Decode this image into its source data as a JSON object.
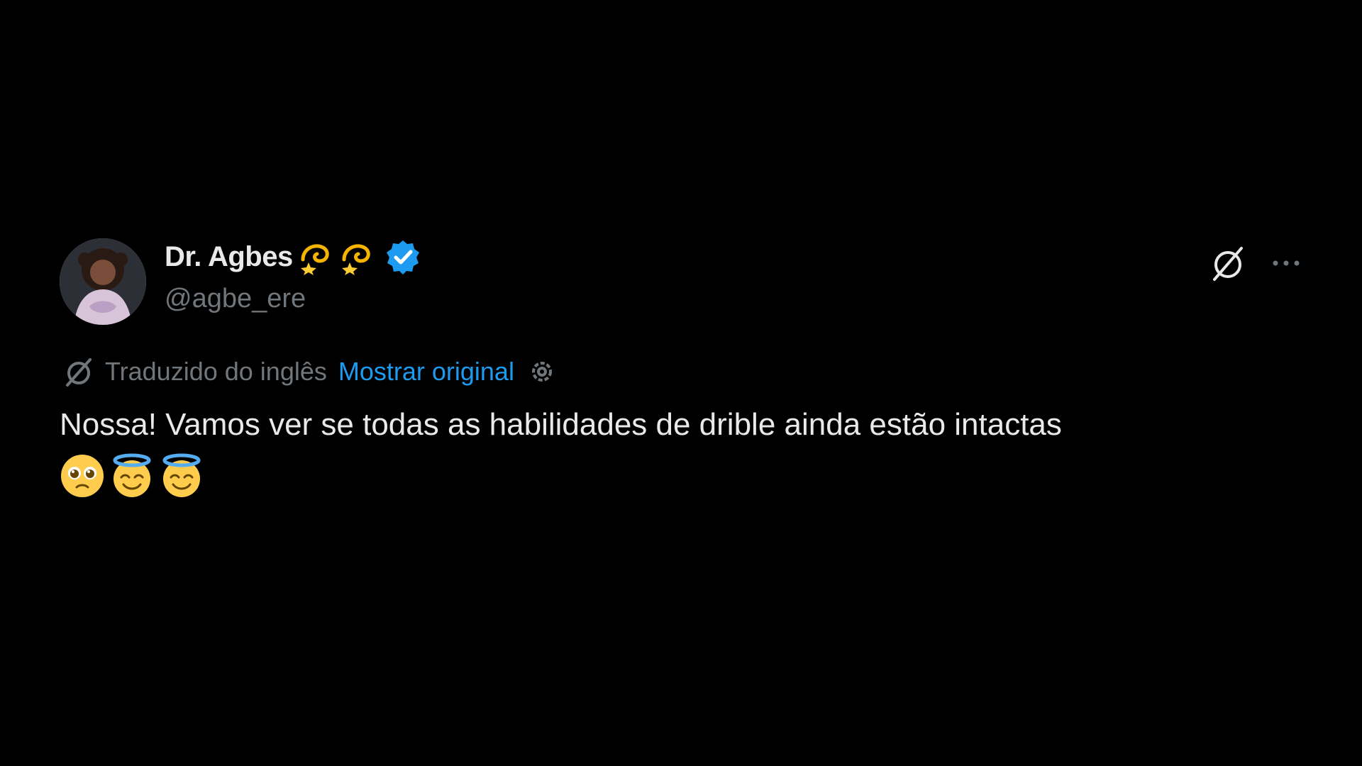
{
  "tweet": {
    "author": {
      "display_name": "Dr. Agbes",
      "name_emojis": [
        "dizzy-emoji",
        "dizzy-emoji"
      ],
      "verified": true,
      "handle": "@agbe_ere"
    },
    "translation": {
      "notice": "Traduzido do inglês",
      "show_original_label": "Mostrar original"
    },
    "text": "Nossa! Vamos ver se todas as habilidades de drible ainda estão intactas",
    "emojis": [
      "pleading-face-emoji",
      "smiling-face-with-halo-emoji",
      "smiling-face-with-halo-emoji"
    ]
  },
  "colors": {
    "background": "#000000",
    "text_primary": "#e7e9ea",
    "text_secondary": "#71767b",
    "accent": "#1d9bf0"
  }
}
